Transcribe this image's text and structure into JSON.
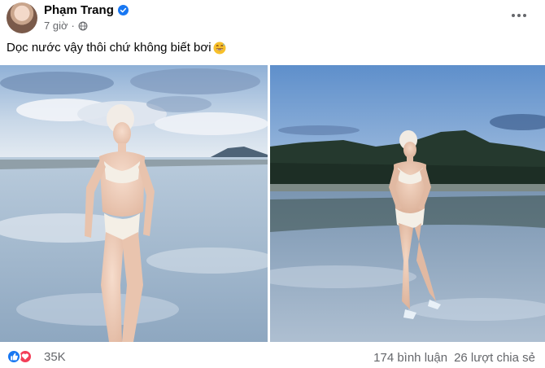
{
  "post": {
    "author": "Phạm Trang",
    "timestamp": "7 giờ",
    "visibility_icon": "globe-icon",
    "caption": "Dọc nước vậy thôi chứ không biết bơi",
    "caption_emoji": "grinning-sweat-emoji",
    "more_icon": "more-dots-icon"
  },
  "photos": [
    {
      "scene": "woman in white bikini on wet sand, cloudy sky"
    },
    {
      "scene": "woman in white bikini standing in shallow water, mountains"
    }
  ],
  "footer": {
    "reactions": [
      "like-icon",
      "love-icon"
    ],
    "reaction_count": "35K",
    "comments": "174 bình luận",
    "shares": "26 lượt chia sẻ"
  },
  "colors": {
    "verified": "#1877f2",
    "like": "#1877f2",
    "love": "#f33e58",
    "secondary_text": "#65676b"
  }
}
